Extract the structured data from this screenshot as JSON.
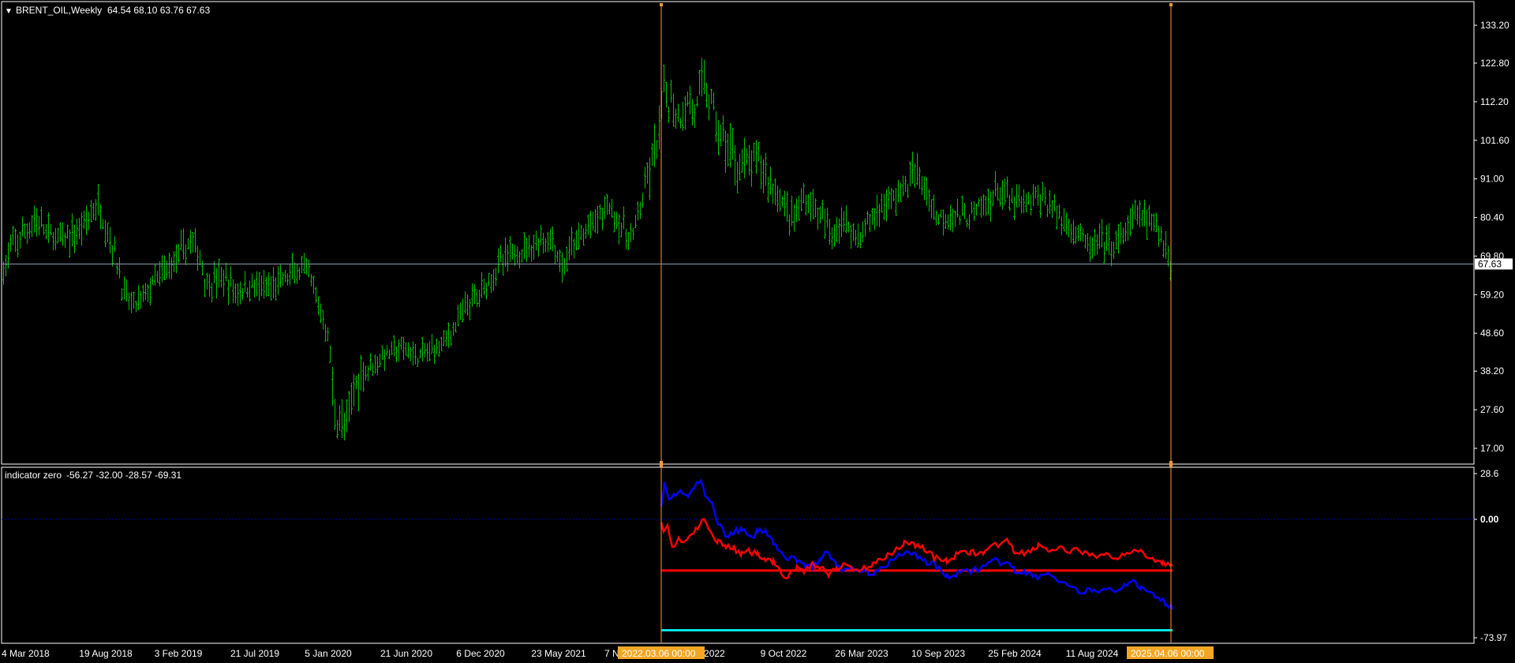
{
  "colors": {
    "background": "#000000",
    "frame": "#ffffff",
    "bars": "#00c000",
    "marker_line": "#ff9933",
    "marker_label_bg": "#f5a623",
    "blue_series": "#0000ff",
    "red_series": "#ff0000",
    "cyan_line": "#00e5e5",
    "zero_line": "#0000aa",
    "price_line": "#8899aa"
  },
  "main_panel": {
    "title": "BRENT_OIL,Weekly",
    "ohlc_values": "64.54 68.10 63.76 67.63",
    "dropdown_icon": "triangle-down-icon",
    "current_price_label": "67.63"
  },
  "indicator_panel": {
    "title": "indicator zero",
    "values": "-56.27 -32.00 -28.57 -69.31"
  },
  "markers": {
    "start_label": "2022.03.06 00:00",
    "end_label": "2025.04.06 00:00"
  },
  "chart_data": [
    {
      "type": "bar",
      "title": "BRENT_OIL,Weekly",
      "subtype": "ohlc",
      "ylim": [
        17.0,
        133.2
      ],
      "y_ticks": [
        "133.20",
        "122.80",
        "112.20",
        "101.60",
        "91.00",
        "80.40",
        "69.80",
        "59.20",
        "48.60",
        "38.20",
        "27.60",
        "17.00"
      ],
      "x_ticks": [
        "4 Mar 2018",
        "19 Aug 2018",
        "3 Feb 2019",
        "21 Jul 2019",
        "5 Jan 2020",
        "21 Jun 2020",
        "6 Dec 2020",
        "23 May 2021",
        "7 Nov 2021",
        "24 Apr 2022",
        "9 Oct 2022",
        "26 Mar 2023",
        "10 Sep 2023",
        "25 Feb 2024",
        "11 Aug 2024"
      ],
      "x": [
        "4 Mar 2018",
        "19 Aug 2018",
        "3 Feb 2019",
        "21 Jul 2019",
        "5 Jan 2020",
        "19 Apr 2020",
        "21 Jun 2020",
        "6 Dec 2020",
        "23 May 2021",
        "7 Nov 2021",
        "6 Mar 2022",
        "24 Apr 2022",
        "9 Oct 2022",
        "26 Mar 2023",
        "10 Sep 2023",
        "25 Feb 2024",
        "11 Aug 2024",
        "6 Apr 2025"
      ],
      "series": [
        {
          "values": [
            65,
            78,
            62,
            64,
            65,
            20,
            42,
            50,
            68,
            82,
            122,
            112,
            92,
            76,
            94,
            82,
            78,
            67.63
          ]
        }
      ],
      "current_value": 67.63,
      "grid": false
    },
    {
      "type": "line",
      "title": "indicator zero",
      "ylim": [
        -73.97,
        28.6
      ],
      "y_ticks": [
        "28.6",
        "0.00",
        "-73.97"
      ],
      "x": [
        "6 Mar 2022",
        "24 Apr 2022",
        "9 Oct 2022",
        "26 Mar 2023",
        "10 Sep 2023",
        "25 Feb 2024",
        "11 Aug 2024",
        "6 Apr 2025"
      ],
      "series": [
        {
          "color": "#0000ff",
          "values": [
            13,
            20,
            -10,
            -22,
            -20,
            -18,
            -40,
            -56.27
          ]
        },
        {
          "color": "#ff0000",
          "values": [
            0,
            0,
            -28,
            -30,
            -15,
            -18,
            -22,
            -28.57
          ]
        }
      ],
      "horizontal_levels": [
        {
          "color": "#ff0000",
          "value": -32.0
        },
        {
          "color": "#00e5e5",
          "value": -69.31
        },
        {
          "color": "#0000aa",
          "value": 0.0,
          "style": "dotted"
        }
      ],
      "grid": false
    }
  ]
}
